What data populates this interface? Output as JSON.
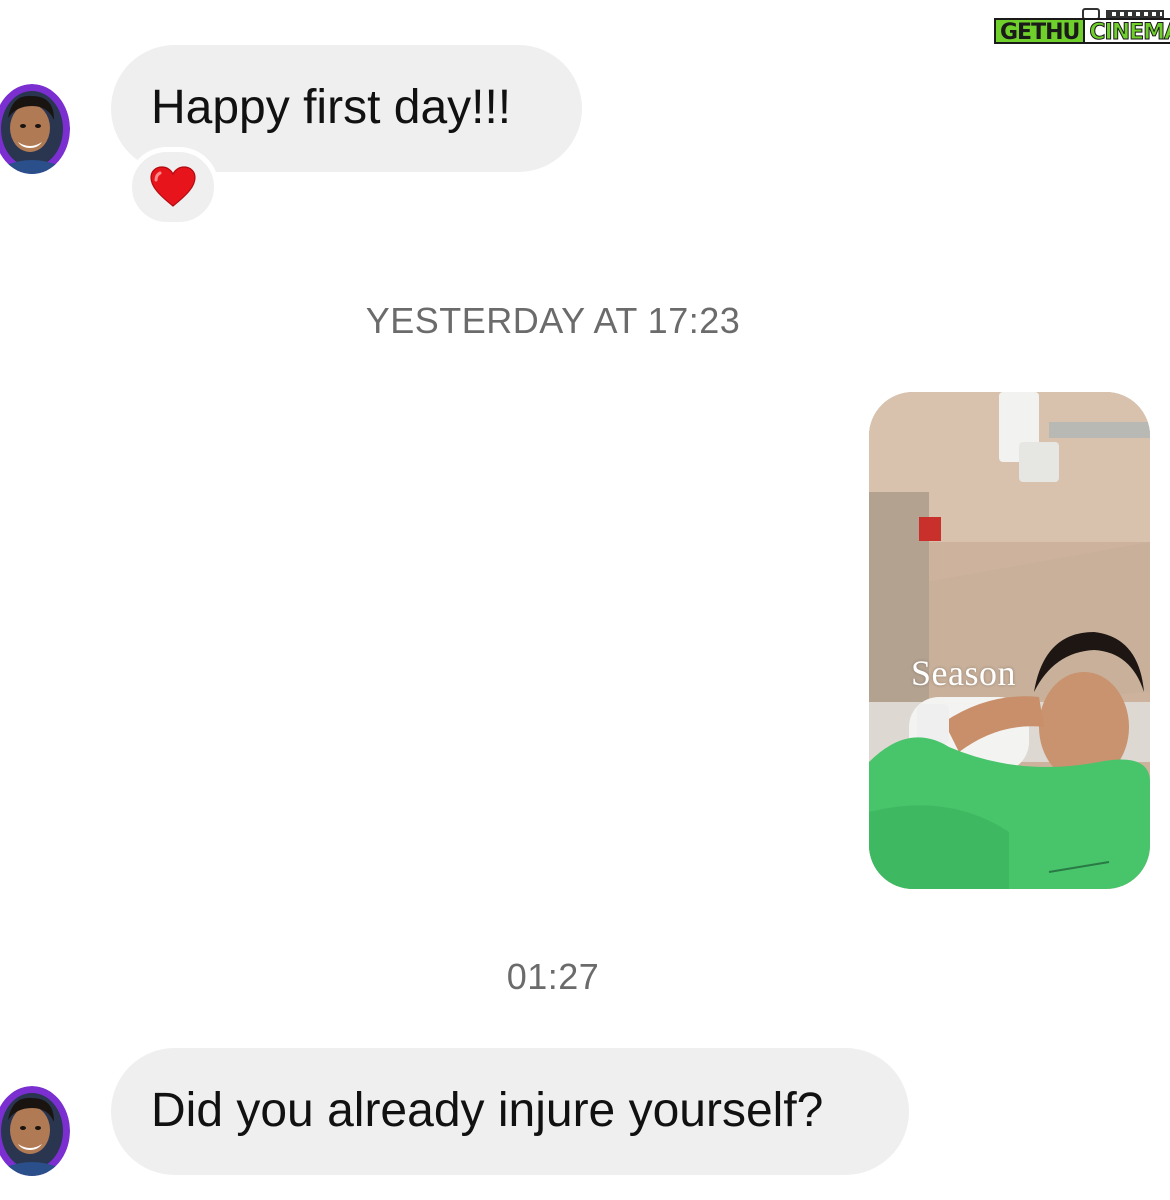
{
  "watermark": {
    "brand_part1": "GETHU",
    "brand_part2": "CINEMA"
  },
  "messages": [
    {
      "sender": "other",
      "text": "Happy first day!!!",
      "reaction": "❤️"
    },
    {
      "sender": "me",
      "type": "photo",
      "caption": "Season"
    },
    {
      "sender": "other",
      "text": "Did you already injure yourself?"
    }
  ],
  "timestamps": [
    "YESTERDAY AT 17:23",
    "01:27"
  ],
  "colors": {
    "incoming_bubble": "#efefef",
    "timestamp_text": "#6b6b6b",
    "avatar_ring": "#7b2fd0",
    "logo_green": "#6fd02b"
  }
}
